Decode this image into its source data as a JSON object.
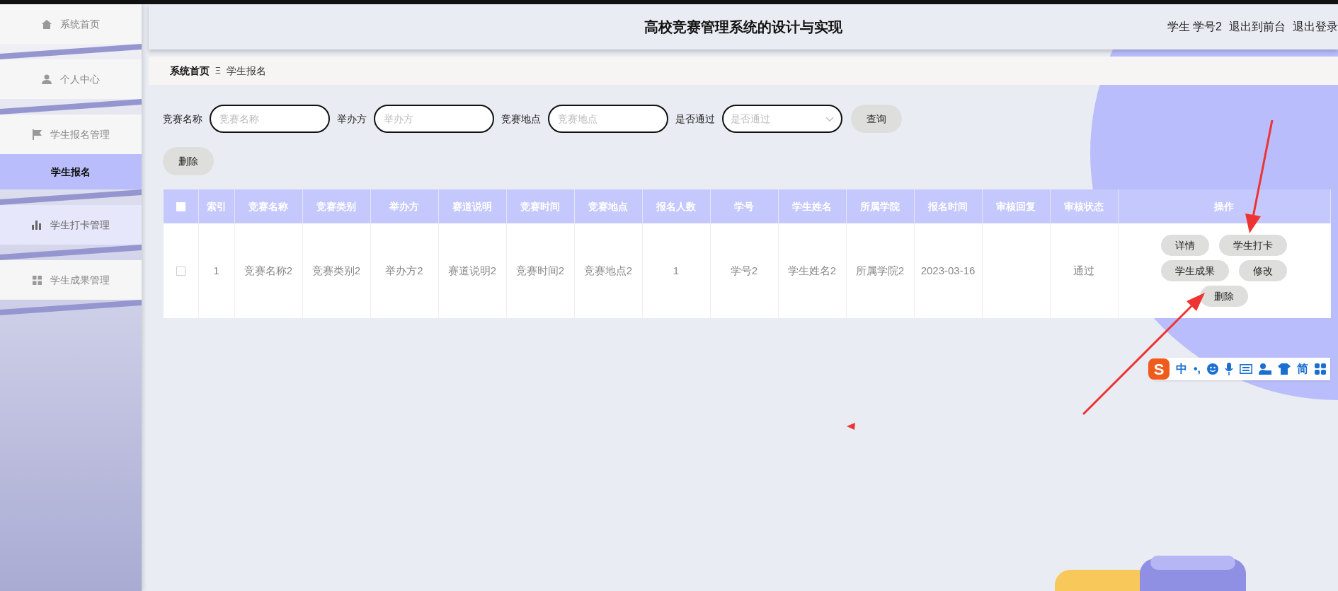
{
  "sidebar": {
    "items": [
      {
        "label": "系统首页",
        "selected": false,
        "hovered": false
      },
      {
        "label": "个人中心",
        "selected": false,
        "hovered": false
      },
      {
        "label": "学生报名管理",
        "selected": false,
        "hovered": false,
        "children": [
          {
            "label": "学生报名",
            "selected": true
          }
        ]
      },
      {
        "label": "学生打卡管理",
        "selected": false,
        "hovered": true
      },
      {
        "label": "学生成果管理",
        "selected": false,
        "hovered": false
      }
    ]
  },
  "header": {
    "title": "高校竞赛管理系统的设计与实现",
    "user_links": [
      "学生 学号2",
      "退出到前台",
      "退出登录"
    ]
  },
  "breadcrumb": {
    "items": [
      "系统首页",
      "学生报名"
    ],
    "separator": "Ξ"
  },
  "search": {
    "fields": [
      {
        "label": "竞赛名称",
        "placeholder": "竞赛名称",
        "kind": "input"
      },
      {
        "label": "举办方",
        "placeholder": "举办方",
        "kind": "input"
      },
      {
        "label": "竞赛地点",
        "placeholder": "竞赛地点",
        "kind": "input"
      },
      {
        "label": "是否通过",
        "placeholder": "是否通过",
        "kind": "select"
      }
    ],
    "button": "查询"
  },
  "toolbar": {
    "buttons": [
      "删除"
    ]
  },
  "table": {
    "columns": [
      "索引",
      "竞赛名称",
      "竞赛类别",
      "举办方",
      "赛道说明",
      "竞赛时间",
      "竞赛地点",
      "报名人数",
      "学号",
      "学生姓名",
      "所属学院",
      "报名时间",
      "审核回复",
      "审核状态",
      "操作"
    ],
    "header_checked": false,
    "rows": [
      {
        "checked": false,
        "cells": [
          "1",
          "竞赛名称2",
          "竞赛类别2",
          "举办方2",
          "赛道说明2",
          "竞赛时间2",
          "竞赛地点2",
          "1",
          "学号2",
          "学生姓名2",
          "所属学院2",
          "2023-03-16",
          "",
          "通过"
        ],
        "actions": [
          "详情",
          "学生打卡",
          "学生成果",
          "修改",
          "删除"
        ]
      }
    ]
  },
  "ime_toolbar": {
    "items": [
      {
        "kind": "logo",
        "text": "S"
      },
      {
        "kind": "text",
        "text": "中"
      },
      {
        "kind": "text",
        "text": "•,"
      },
      {
        "kind": "icon"
      },
      {
        "kind": "icon"
      },
      {
        "kind": "icon"
      },
      {
        "kind": "icon"
      },
      {
        "kind": "icon"
      },
      {
        "kind": "text",
        "text": "简"
      },
      {
        "kind": "icon"
      }
    ]
  }
}
